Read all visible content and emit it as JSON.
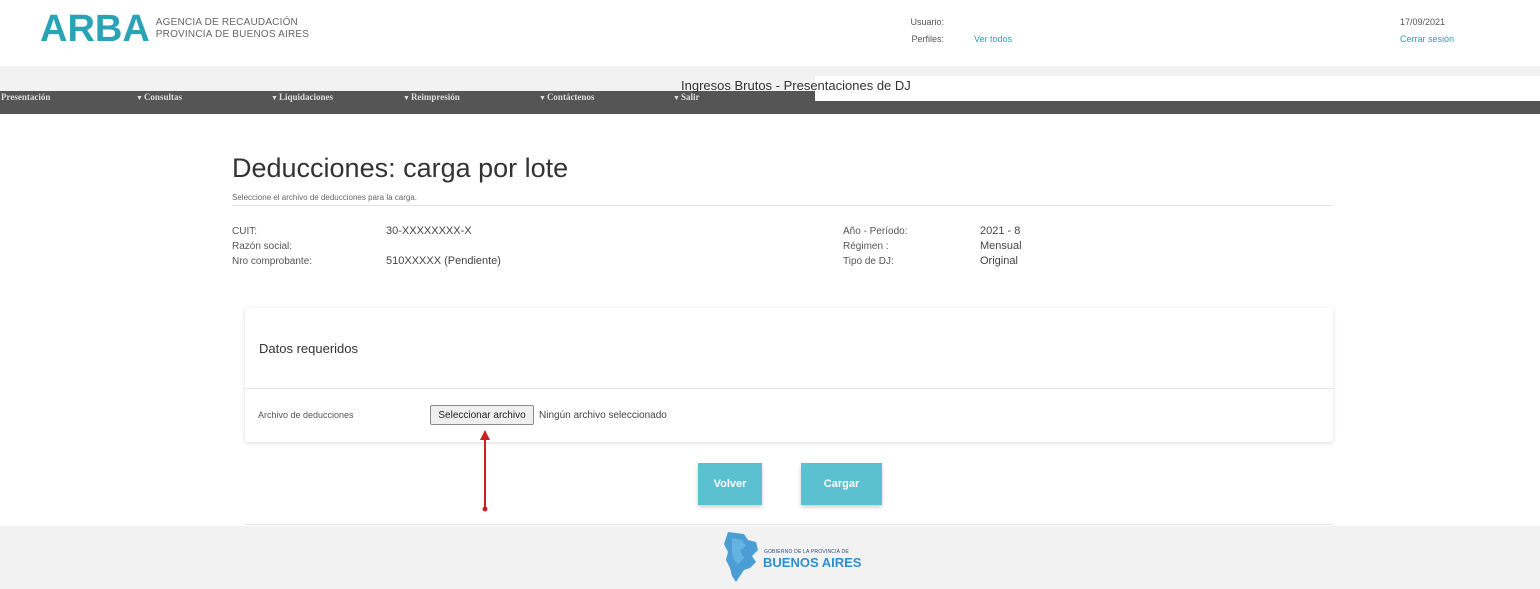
{
  "header": {
    "logo_text": "ARBA",
    "logo_line1": "AGENCIA DE RECAUDACIÓN",
    "logo_line2": "PROVINCIA DE BUENOS AIRES",
    "user_label": "Usuario:",
    "profiles_label": "Perfiles:",
    "profiles_link": "Ver todos",
    "date": "17/09/2021",
    "logout": "Cerrar sesión"
  },
  "nav": {
    "system_title": "Ingresos Brutos - Presentaciones de DJ",
    "items": [
      {
        "label": "Presentación",
        "caret": ""
      },
      {
        "label": "Consultas",
        "caret": "▼"
      },
      {
        "label": "Liquidaciones",
        "caret": "▼"
      },
      {
        "label": "Reimpresión",
        "caret": "▼"
      },
      {
        "label": "Contáctenos",
        "caret": "▼"
      },
      {
        "label": "Salir",
        "caret": "▼"
      }
    ]
  },
  "page": {
    "title": "Deducciones: carga por lote",
    "subtitle": "Seleccione el archivo de deducciones para la carga."
  },
  "info": {
    "cuit_label": "CUIT:",
    "cuit_value": "30-XXXXXXXX-X",
    "razon_label": "Razón social:",
    "razon_value": "",
    "nro_label": "Nro comprobante:",
    "nro_value": "510XXXXX (Pendiente)",
    "anio_label": "Año - Período:",
    "anio_value": "2021 - 8",
    "regimen_label": "Régimen :",
    "regimen_value": "Mensual",
    "tipo_label": "Tipo de DJ:",
    "tipo_value": "Original"
  },
  "panel": {
    "title": "Datos requeridos",
    "field_label": "Archivo de deducciones",
    "file_button": "Seleccionar archivo",
    "file_status": "Ningún archivo seleccionado"
  },
  "actions": {
    "back": "Volver",
    "submit": "Cargar"
  },
  "footer": {
    "small_text": "GOBIERNO DE LA PROVINCIA DE",
    "big_text": "BUENOS AIRES"
  },
  "colors": {
    "accent": "#2aa3b5",
    "button": "#5bc0cf",
    "nav_dark": "#555555",
    "arrow": "#cc1f1f"
  }
}
